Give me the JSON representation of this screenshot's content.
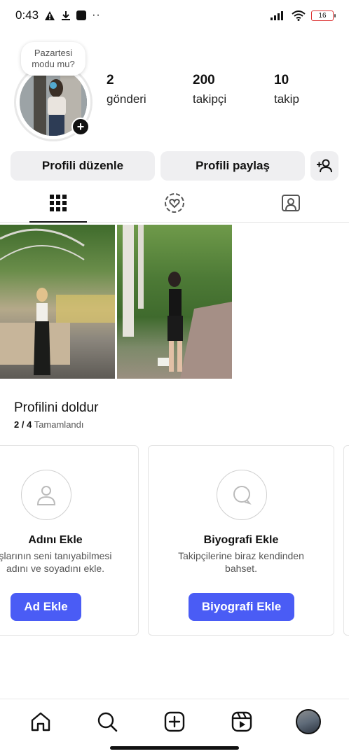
{
  "status_bar": {
    "time": "0:43",
    "battery": "16"
  },
  "profile": {
    "note": "Pazartesi modu mu?",
    "stats": [
      {
        "value": "2",
        "label": "gönderi"
      },
      {
        "value": "200",
        "label": "takipçi"
      },
      {
        "value": "10",
        "label": "takip"
      }
    ]
  },
  "actions": {
    "edit_label": "Profili düzenle",
    "share_label": "Profili paylaş"
  },
  "tabs": [
    {
      "icon": "grid-icon",
      "active": true
    },
    {
      "icon": "heart-circle-icon",
      "active": false
    },
    {
      "icon": "tagged-person-icon",
      "active": false
    }
  ],
  "posts": [
    {
      "icon": "photo"
    },
    {
      "icon": "photo"
    }
  ],
  "completion": {
    "title": "Profilini doldur",
    "progress": "2 / 4",
    "progress_label": "Tamamlandı",
    "cards": [
      {
        "title": "Adını Ekle",
        "desc_line1": "şlarının seni tanıyabilmesi",
        "desc_line2": "adını ve soyadını ekle.",
        "button": "Ad Ekle",
        "icon": "person-icon"
      },
      {
        "title": "Biyografi Ekle",
        "desc_line1": "Takipçilerine biraz kendinden",
        "desc_line2": "bahset.",
        "button": "Biyografi Ekle",
        "icon": "speech-bubble-icon"
      }
    ]
  },
  "bottom_nav": [
    {
      "icon": "home-icon"
    },
    {
      "icon": "search-icon"
    },
    {
      "icon": "create-icon"
    },
    {
      "icon": "reels-icon"
    },
    {
      "icon": "profile-avatar"
    }
  ],
  "colors": {
    "accent": "#4a5cf5",
    "button_bg": "#efeff1"
  }
}
